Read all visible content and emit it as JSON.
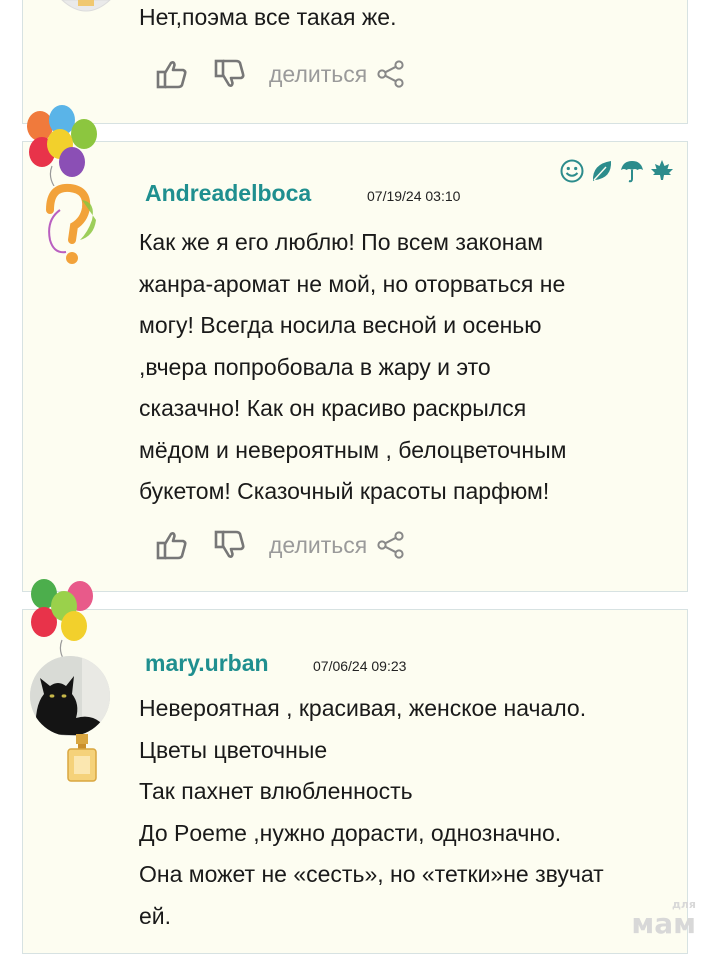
{
  "comments": [
    {
      "text": "Нет,поэма все такая же.",
      "share_label": "делиться"
    },
    {
      "author": "Andreadelboca",
      "date": "07/19/24 03:10",
      "lines": [
        "Как же я его люблю! По всем законам",
        "жанра-аромат не мой, но оторваться не",
        "могу! Всегда носила весной и осенью",
        ",вчера попробовала в жару и это",
        "сказачно! Как он красиво раскрылся",
        "мёдом и невероятным , белоцветочным",
        "букетом! Сказочный красоты парфюм!"
      ],
      "share_label": "делиться",
      "badges": [
        "smiley-icon",
        "leaf-icon",
        "umbrella-icon",
        "maple-leaf-icon"
      ]
    },
    {
      "author": "mary.urban",
      "date": "07/06/24 09:23",
      "lines": [
        "Невероятная , красивая, женское начало.",
        "Цветы цветочные",
        "Так пахнет влюбленность",
        "До Poeme ,нужно дорасти, однозначно.",
        "Она может не «сесть», но «тетки»не звучат",
        "ей."
      ]
    }
  ],
  "watermark": {
    "top": "для",
    "bottom": "мам"
  },
  "colors": {
    "author": "#1f8f8f",
    "card_bg": "#fdfdf1",
    "card_border": "#d7e2e2",
    "share": "#9a9a9a"
  }
}
